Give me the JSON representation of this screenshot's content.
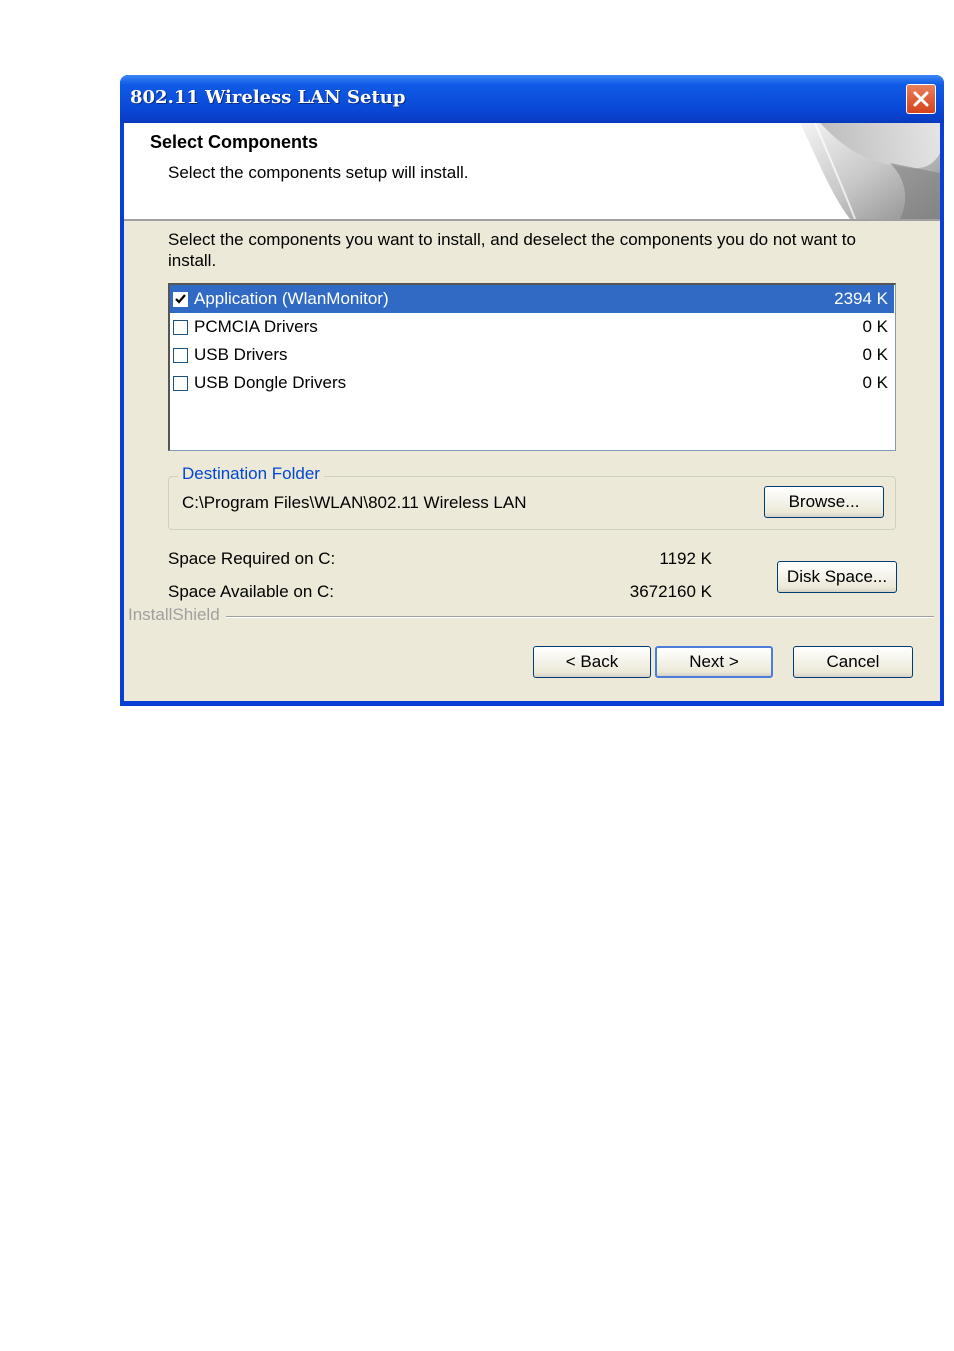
{
  "window": {
    "title": "802.11 Wireless LAN Setup"
  },
  "header": {
    "title": "Select Components",
    "subtitle": "Select the components setup will install."
  },
  "instructions": "Select the components you want to install, and deselect the components you do not want to install.",
  "components": [
    {
      "label": "Application (WlanMonitor)",
      "size": "2394 K",
      "checked": true,
      "selected": true
    },
    {
      "label": "PCMCIA Drivers",
      "size": "0 K",
      "checked": false,
      "selected": false
    },
    {
      "label": "USB Drivers",
      "size": "0 K",
      "checked": false,
      "selected": false
    },
    {
      "label": "USB Dongle Drivers",
      "size": "0 K",
      "checked": false,
      "selected": false
    }
  ],
  "destination": {
    "legend": "Destination Folder",
    "path": "C:\\Program Files\\WLAN\\802.11 Wireless LAN",
    "browse_label": "Browse..."
  },
  "space": {
    "required_label": "Space Required on C:",
    "required_value": "1192 K",
    "available_label": "Space Available on C:",
    "available_value": "3672160 K",
    "disk_space_label": "Disk Space..."
  },
  "brand": "InstallShield",
  "footer": {
    "back_label": "< Back",
    "next_label": "Next >",
    "cancel_label": "Cancel"
  },
  "colors": {
    "title_bar": "#0a49d8",
    "selection": "#316ac5",
    "dialog_bg": "#ece9d8",
    "legend_text": "#0046d5"
  },
  "icons": {
    "close": "close-x-icon",
    "check": "checkmark-icon",
    "header_art": "page-curl-art"
  }
}
